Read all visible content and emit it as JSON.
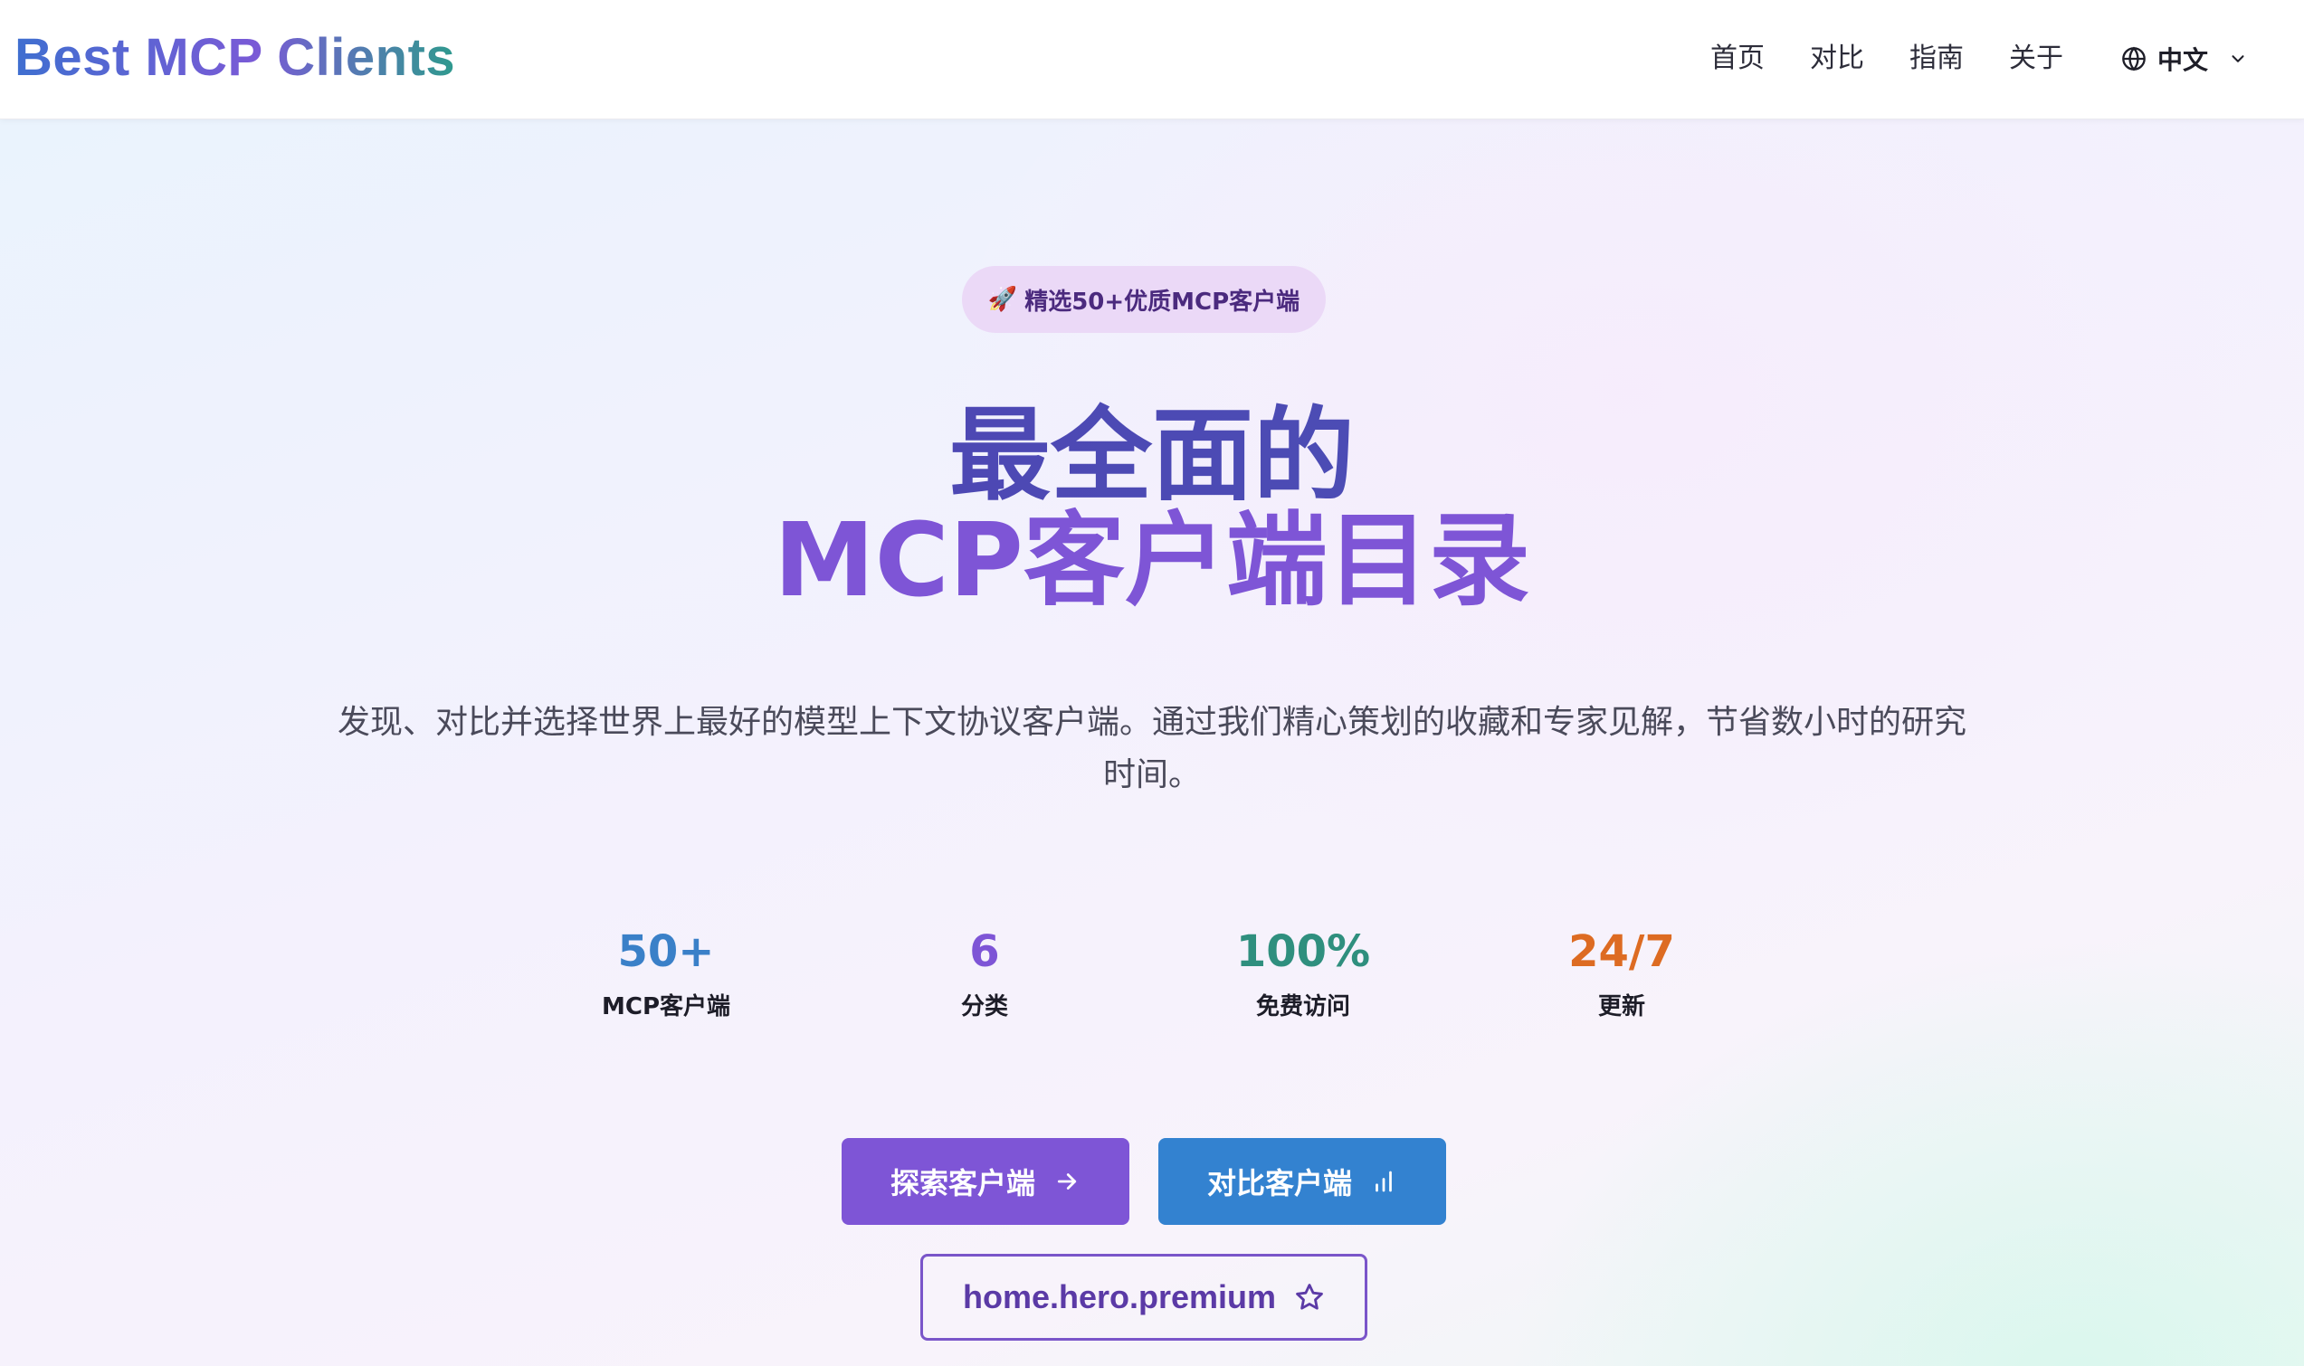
{
  "header": {
    "brand": "Best MCP Clients",
    "nav": [
      {
        "label": "首页"
      },
      {
        "label": "对比"
      },
      {
        "label": "指南"
      },
      {
        "label": "关于"
      }
    ],
    "language": {
      "label": "中文",
      "icon": "globe-icon"
    }
  },
  "hero": {
    "badge": {
      "icon": "🚀",
      "text": "精选50+优质MCP客户端"
    },
    "title_line1": "最全面的",
    "title_line2": "MCP客户端目录",
    "subtitle": "发现、对比并选择世界上最好的模型上下文协议客户端。通过我们精心策划的收藏和专家见解，节省数小时的研究时间。",
    "stats": [
      {
        "value": "50+",
        "label": "MCP客户端",
        "color": "#3a80c8"
      },
      {
        "value": "6",
        "label": "分类",
        "color": "#7e55d6"
      },
      {
        "value": "100%",
        "label": "免费访问",
        "color": "#2f8f7e"
      },
      {
        "value": "24/7",
        "label": "更新",
        "color": "#dd6b22"
      }
    ],
    "buttons": {
      "explore": "探索客户端",
      "compare": "对比客户端",
      "premium": "home.hero.premium"
    }
  },
  "colors": {
    "accent_purple": "#7e55d6",
    "accent_blue": "#3382d0",
    "badge_bg": "#ebd9f7"
  }
}
